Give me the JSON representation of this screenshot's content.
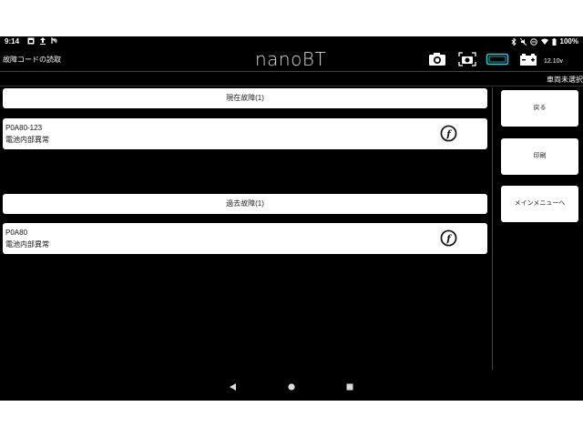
{
  "status_bar": {
    "time": "9:14",
    "battery": "100%",
    "left_icons": [
      "image-icon",
      "upload-icon",
      "nfc-icon"
    ],
    "right_icons": [
      "bluetooth-icon",
      "mute-icon",
      "dnd-icon",
      "wifi-icon",
      "battery-icon"
    ]
  },
  "app_bar": {
    "screen_title": "故障コードの読取",
    "logo": "nanoBT",
    "tools": [
      "camera-icon",
      "screenshot-icon",
      "connector-icon",
      "battery-status-icon"
    ],
    "voltage": "12.10v",
    "accent_color": "#35c6d6"
  },
  "vehicle": {
    "label": "車両未選択"
  },
  "sections": [
    {
      "header": "現在故障(1)",
      "codes": [
        {
          "id": "P0A80-123",
          "desc": "電池内部異常",
          "icon": "freeze-frame-icon",
          "icon_glyph": "f"
        }
      ]
    },
    {
      "header": "過去故障(1)",
      "codes": [
        {
          "id": "P0A80",
          "desc": "電池内部異常",
          "icon": "freeze-frame-icon",
          "icon_glyph": "f"
        }
      ]
    }
  ],
  "sidebar": {
    "back": "戻る",
    "print": "印刷",
    "main_menu": "メインメニューへ"
  },
  "nav": [
    "back-icon",
    "home-icon",
    "recents-icon"
  ]
}
